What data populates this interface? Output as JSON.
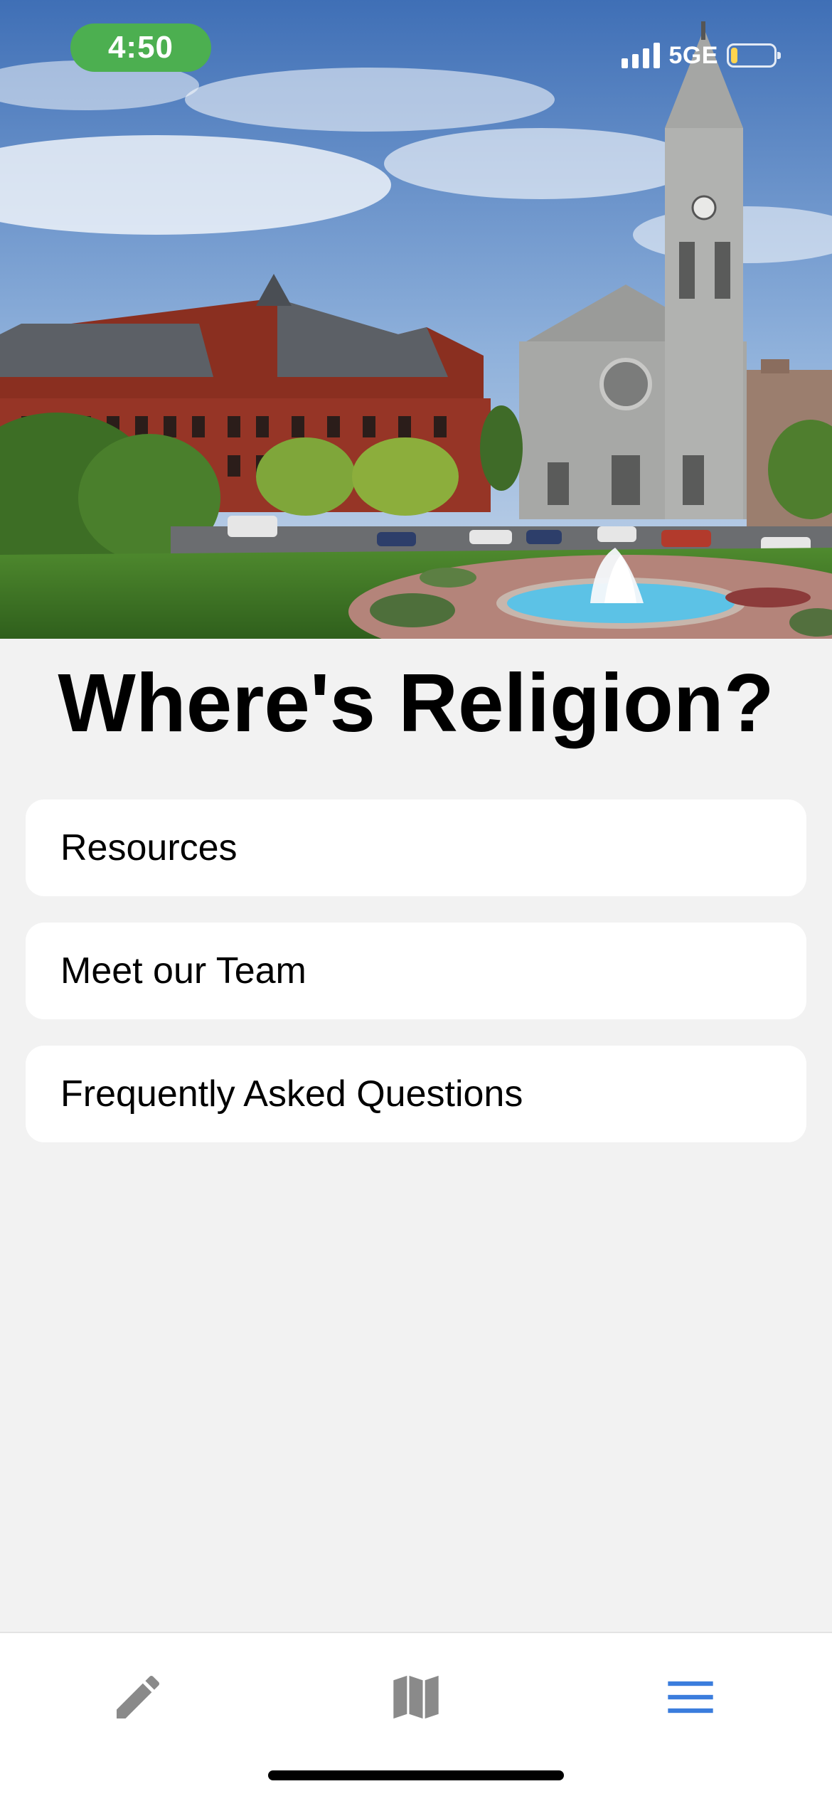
{
  "status_bar": {
    "time": "4:50",
    "network": "5GE",
    "battery_level": 0.15,
    "signal_bars": 4
  },
  "hero": {
    "icon": "campus-photo"
  },
  "page": {
    "title": "Where's Religion?"
  },
  "menu": {
    "items": [
      {
        "label": "Resources"
      },
      {
        "label": "Meet our Team"
      },
      {
        "label": "Frequently Asked Questions"
      }
    ]
  },
  "tab_bar": {
    "items": [
      {
        "icon": "pencil-icon",
        "active": false
      },
      {
        "icon": "map-icon",
        "active": false
      },
      {
        "icon": "menu-icon",
        "active": true
      }
    ],
    "active_color": "#3b7ddd",
    "inactive_color": "#8a8a8a"
  },
  "colors": {
    "time_pill": "#4caf50",
    "background": "#f2f2f2",
    "card": "#ffffff"
  }
}
